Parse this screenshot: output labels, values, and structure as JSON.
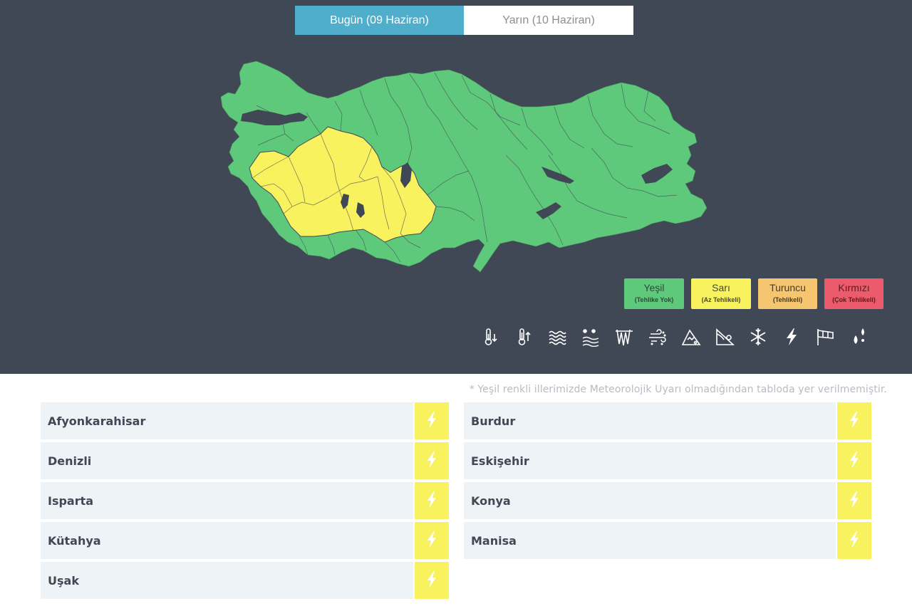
{
  "tabs": [
    {
      "label": "Bugün (09 Haziran)",
      "active": true
    },
    {
      "label": "Yarın (10 Haziran)",
      "active": false
    }
  ],
  "legend": [
    {
      "label": "Yeşil",
      "sub": "(Tehlike Yok)",
      "color": "#5ec97a",
      "text_color": "#2e4a37"
    },
    {
      "label": "Sarı",
      "sub": "(Az Tehlikeli)",
      "color": "#f7f25e",
      "text_color": "#4a4a2a"
    },
    {
      "label": "Turuncu",
      "sub": "(Tehlikeli)",
      "color": "#f6c56f",
      "text_color": "#4a3a22"
    },
    {
      "label": "Kırmızı",
      "sub": "(Çok Tehlikeli)",
      "color": "#ec5b6b",
      "text_color": "#5a1a22"
    }
  ],
  "hazard_icons": [
    "low-temperature-icon",
    "high-temperature-icon",
    "rain-icon",
    "snowmelt-icon",
    "fog-icon",
    "wind-dust-icon",
    "avalanche-icon",
    "landslide-icon",
    "snow-icon",
    "thunderstorm-icon",
    "wind-icon",
    "hail-icon"
  ],
  "map_colors": {
    "green": "#5ec97a",
    "yellow": "#f7f25e",
    "border": "#404855",
    "lake": "#404855"
  },
  "note": "* Yeşil renkli illerimizde Meteorolojik Uyarı olmadığından tabloda yer verilmemiştir.",
  "warning_color": "#f7f25e",
  "provinces_left": [
    {
      "name": "Afyonkarahisar",
      "icon": "thunderstorm-icon"
    },
    {
      "name": "Denizli",
      "icon": "thunderstorm-icon"
    },
    {
      "name": "Isparta",
      "icon": "thunderstorm-icon"
    },
    {
      "name": "Kütahya",
      "icon": "thunderstorm-icon"
    },
    {
      "name": "Uşak",
      "icon": "thunderstorm-icon"
    }
  ],
  "provinces_right": [
    {
      "name": "Burdur",
      "icon": "thunderstorm-icon"
    },
    {
      "name": "Eskişehir",
      "icon": "thunderstorm-icon"
    },
    {
      "name": "Konya",
      "icon": "thunderstorm-icon"
    },
    {
      "name": "Manisa",
      "icon": "thunderstorm-icon"
    }
  ]
}
